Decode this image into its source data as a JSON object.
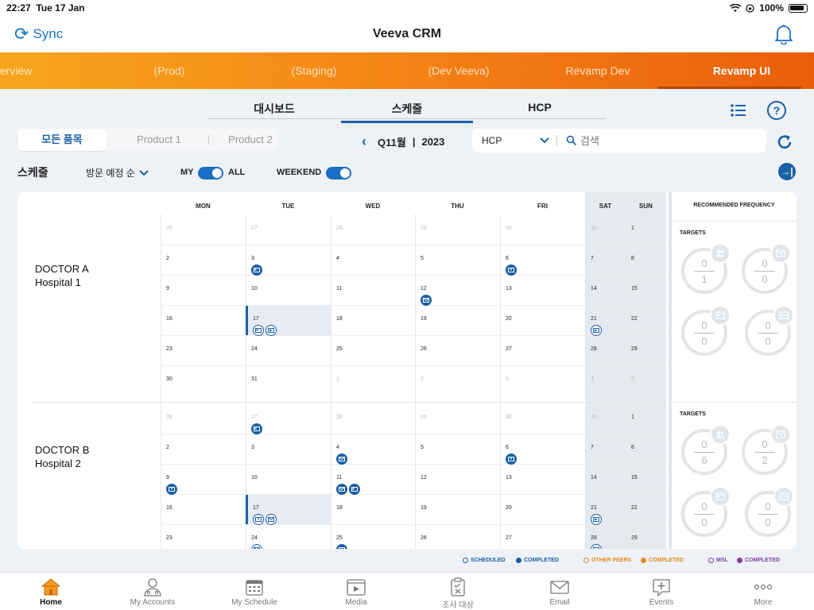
{
  "status": {
    "time": "22:27",
    "date": "Tue 17 Jan",
    "battery": "100%"
  },
  "app": {
    "sync_label": "Sync",
    "title": "Veeva CRM"
  },
  "env_tabs": [
    {
      "label": "erview"
    },
    {
      "label": "(Prod)"
    },
    {
      "label": "(Staging)"
    },
    {
      "label": "(Dev Veeva)"
    },
    {
      "label": "Revamp Dev"
    },
    {
      "label": "Revamp UI"
    }
  ],
  "view_tabs": [
    "대시보드",
    "스케줄",
    "HCP"
  ],
  "products": [
    "모든 품목",
    "Product 1",
    "Product 2"
  ],
  "period": {
    "quarter": "Q11월",
    "sep": "|",
    "year": "2023"
  },
  "search": {
    "type": "HCP",
    "placeholder": "검색"
  },
  "controls": {
    "schedule": "스케줄",
    "sort": "방문 예정 순",
    "my": "MY",
    "all": "ALL",
    "weekend": "WEEKEND"
  },
  "calendar": {
    "days": [
      "MON",
      "TUE",
      "WED",
      "THU",
      "FRI",
      "SAT",
      "SUN"
    ],
    "recommended_title": "RECOMMENDED FREQUENCY",
    "targets_label": "TARGETS",
    "doctors": [
      {
        "name": "DOCTOR A",
        "hospital": "Hospital 1",
        "weeks": [
          [
            "26",
            "27",
            "28",
            "29",
            "30",
            "31",
            "1"
          ],
          [
            "2",
            "3",
            "4",
            "5",
            "6",
            "7",
            "8"
          ],
          [
            "9",
            "10",
            "11",
            "12",
            "13",
            "14",
            "15"
          ],
          [
            "16",
            "17",
            "18",
            "19",
            "20",
            "21",
            "22"
          ],
          [
            "23",
            "24",
            "25",
            "26",
            "27",
            "28",
            "29"
          ],
          [
            "30",
            "31",
            "1",
            "2",
            "3",
            "4",
            "5"
          ]
        ],
        "dim": [
          [
            0,
            0
          ],
          [
            0,
            1
          ],
          [
            0,
            2
          ],
          [
            0,
            3
          ],
          [
            0,
            4
          ],
          [
            0,
            5
          ],
          [
            5,
            2
          ],
          [
            5,
            3
          ],
          [
            5,
            4
          ],
          [
            5,
            5
          ],
          [
            5,
            6
          ]
        ],
        "targets": [
          {
            "done": "0",
            "goal": "1",
            "icon": "people"
          },
          {
            "done": "0",
            "goal": "0",
            "icon": "mail"
          },
          {
            "done": "0",
            "goal": "0",
            "icon": "card"
          },
          {
            "done": "0",
            "goal": "0",
            "icon": "email"
          }
        ]
      },
      {
        "name": "DOCTOR B",
        "hospital": "Hospital 2",
        "weeks": [
          [
            "26",
            "27",
            "28",
            "29",
            "30",
            "31",
            "1"
          ],
          [
            "2",
            "3",
            "4",
            "5",
            "6",
            "7",
            "8"
          ],
          [
            "9",
            "10",
            "11",
            "12",
            "13",
            "14",
            "15"
          ],
          [
            "16",
            "17",
            "18",
            "19",
            "20",
            "21",
            "22"
          ],
          [
            "23",
            "24",
            "25",
            "26",
            "27",
            "28",
            "29"
          ]
        ],
        "dim": [
          [
            0,
            0
          ],
          [
            0,
            1
          ],
          [
            0,
            2
          ],
          [
            0,
            3
          ],
          [
            0,
            4
          ],
          [
            0,
            5
          ]
        ],
        "targets": [
          {
            "done": "0",
            "goal": "6",
            "icon": "people"
          },
          {
            "done": "0",
            "goal": "2",
            "icon": "mail"
          },
          {
            "done": "0",
            "goal": "0",
            "icon": "card"
          },
          {
            "done": "0",
            "goal": "0",
            "icon": "email"
          }
        ]
      }
    ]
  },
  "legend": [
    {
      "label": "SCHEDULED",
      "color": "#1a5fa8",
      "filled": false
    },
    {
      "label": "COMPLETED",
      "color": "#1a5fa8",
      "filled": true
    },
    {
      "label": "OTHER PEERS",
      "color": "#e8871e",
      "filled": false
    },
    {
      "label": "COMPLETED",
      "color": "#e8871e",
      "filled": true
    },
    {
      "label": "MSL",
      "color": "#7b3fa0",
      "filled": false
    },
    {
      "label": "COMPLETED",
      "color": "#7b3fa0",
      "filled": true
    }
  ],
  "bottom_nav": [
    "Home",
    "My Accounts",
    "My Schedule",
    "Media",
    "조사 대상",
    "Email",
    "Events",
    "More"
  ],
  "colors": {
    "accent": "#1a5fa8",
    "env_bar_start": "#f7a51d",
    "env_bar_end": "#ea5e0b",
    "home_icon": "#f39a1f"
  }
}
